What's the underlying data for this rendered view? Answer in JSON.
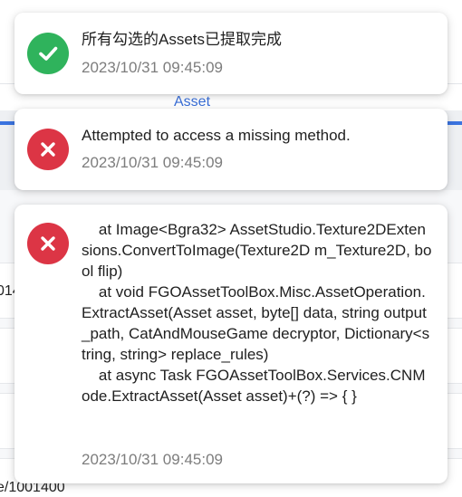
{
  "background": {
    "tab_label": "Asset",
    "row_fragment_1": "014",
    "row_fragment_2": "e/1001400"
  },
  "notifications": [
    {
      "type": "success",
      "icon": "check-icon",
      "message": "所有勾选的Assets已提取完成",
      "timestamp": "2023/10/31 09:45:09"
    },
    {
      "type": "error",
      "icon": "x-icon",
      "message": "Attempted to access a missing method.",
      "timestamp": "2023/10/31 09:45:09"
    },
    {
      "type": "error",
      "icon": "x-icon",
      "message": "    at Image<Bgra32> AssetStudio.Texture2DExtensions.ConvertToImage(Texture2D m_Texture2D, bool flip)\n    at void FGOAssetToolBox.Misc.AssetOperation.ExtractAsset(Asset asset, byte[] data, string output_path, CatAndMouseGame decryptor, Dictionary<string, string> replace_rules)\n    at async Task FGOAssetToolBox.Services.CNMode.ExtractAsset(Asset asset)+(?) => { }",
      "timestamp": "2023/10/31 09:45:09"
    }
  ],
  "colors": {
    "success": "#2fb35c",
    "error": "#dc3545",
    "accent": "#3b74e0"
  }
}
